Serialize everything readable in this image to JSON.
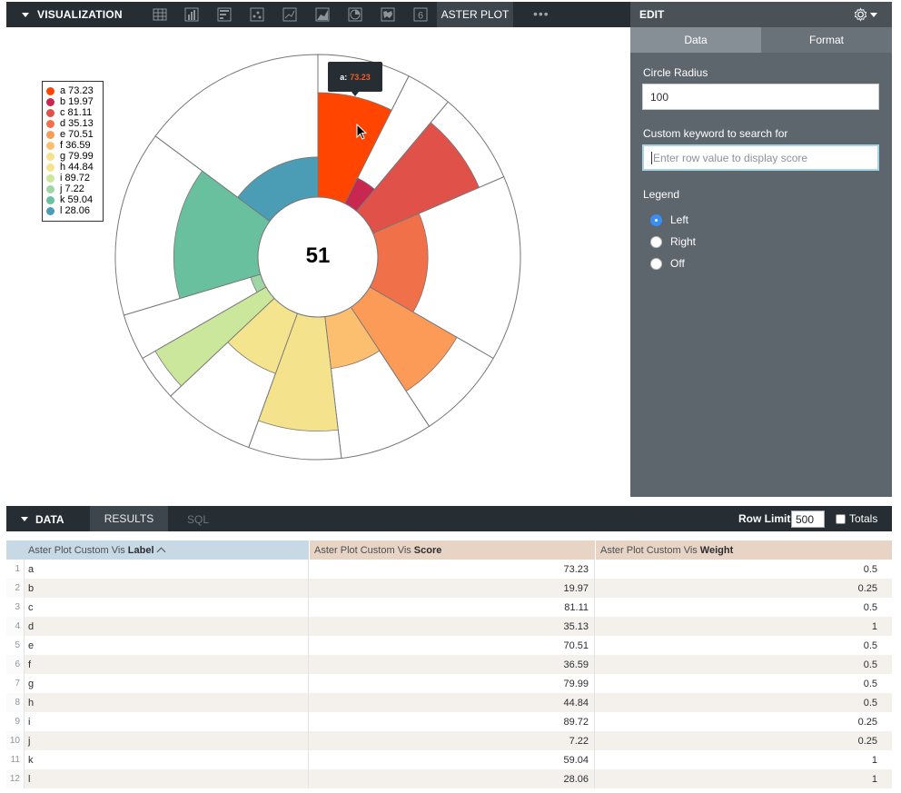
{
  "viz": {
    "title": "VISUALIZATION",
    "toolbar_icons": [
      "table-icon",
      "column-chart-icon",
      "bar-chart-icon",
      "scatter-icon",
      "line-chart-icon",
      "area-chart-icon",
      "pie-chart-icon",
      "map-icon",
      "single-value-icon"
    ],
    "single_value_glyph": "6",
    "active_tab": "ASTER PLOT",
    "more": "•••"
  },
  "edit": {
    "title": "EDIT",
    "tabs": [
      "Data",
      "Format"
    ],
    "circle_radius_label": "Circle Radius",
    "circle_radius_value": "100",
    "keyword_label": "Custom keyword to search for",
    "keyword_placeholder": "Enter row value to display score",
    "legend_label": "Legend",
    "legend_options": [
      {
        "label": "Left",
        "checked": true
      },
      {
        "label": "Right",
        "checked": false
      },
      {
        "label": "Off",
        "checked": false
      }
    ]
  },
  "tooltip": {
    "key": "a:",
    "value": "73.23"
  },
  "chart_data": {
    "type": "aster",
    "center_label": "51",
    "max_value": 100,
    "slices": [
      {
        "label": "a",
        "score": 73.23,
        "weight": 0.5,
        "color": "#ff4500",
        "legend": "a 73.23"
      },
      {
        "label": "b",
        "score": 19.97,
        "weight": 0.25,
        "color": "#c8274f",
        "legend": "b 19.97"
      },
      {
        "label": "c",
        "score": 81.11,
        "weight": 0.5,
        "color": "#e0514a",
        "legend": "c 81.11"
      },
      {
        "label": "d",
        "score": 35.13,
        "weight": 1,
        "color": "#f07049",
        "legend": "d 35.13"
      },
      {
        "label": "e",
        "score": 70.51,
        "weight": 0.5,
        "color": "#fb9b57",
        "legend": "e 70.51"
      },
      {
        "label": "f",
        "score": 36.59,
        "weight": 0.5,
        "color": "#fcbf6f",
        "legend": "f 36.59"
      },
      {
        "label": "g",
        "score": 79.99,
        "weight": 0.5,
        "color": "#f4e38c",
        "legend": "g 79.99"
      },
      {
        "label": "h",
        "score": 44.84,
        "weight": 0.5,
        "color": "#f4e48e",
        "legend": "h 44.84"
      },
      {
        "label": "i",
        "score": 89.72,
        "weight": 0.25,
        "color": "#cbe79c",
        "legend": "i 89.72"
      },
      {
        "label": "j",
        "score": 7.22,
        "weight": 0.25,
        "color": "#9fd6a6",
        "legend": "j 7.22"
      },
      {
        "label": "k",
        "score": 59.04,
        "weight": 1,
        "color": "#68c09e",
        "legend": "k 59.04"
      },
      {
        "label": "l",
        "score": 28.06,
        "weight": 1,
        "color": "#4a9db5",
        "legend": "l 28.06"
      }
    ]
  },
  "data_section": {
    "title": "DATA",
    "tabs": [
      "RESULTS",
      "SQL"
    ],
    "row_limit_label": "Row Limit",
    "row_limit_value": "500",
    "totals_label": "Totals"
  },
  "table": {
    "columns": [
      {
        "prefix": "Aster Plot Custom Vis",
        "field": "Label",
        "sort": "^"
      },
      {
        "prefix": "Aster Plot Custom Vis",
        "field": "Score"
      },
      {
        "prefix": "Aster Plot Custom Vis",
        "field": "Weight"
      }
    ],
    "rows": [
      [
        "1",
        "a",
        "73.23",
        "0.5"
      ],
      [
        "2",
        "b",
        "19.97",
        "0.25"
      ],
      [
        "3",
        "c",
        "81.11",
        "0.5"
      ],
      [
        "4",
        "d",
        "35.13",
        "1"
      ],
      [
        "5",
        "e",
        "70.51",
        "0.5"
      ],
      [
        "6",
        "f",
        "36.59",
        "0.5"
      ],
      [
        "7",
        "g",
        "79.99",
        "0.5"
      ],
      [
        "8",
        "h",
        "44.84",
        "0.5"
      ],
      [
        "9",
        "i",
        "89.72",
        "0.25"
      ],
      [
        "10",
        "j",
        "7.22",
        "0.25"
      ],
      [
        "11",
        "k",
        "59.04",
        "1"
      ],
      [
        "12",
        "l",
        "28.06",
        "1"
      ]
    ]
  }
}
